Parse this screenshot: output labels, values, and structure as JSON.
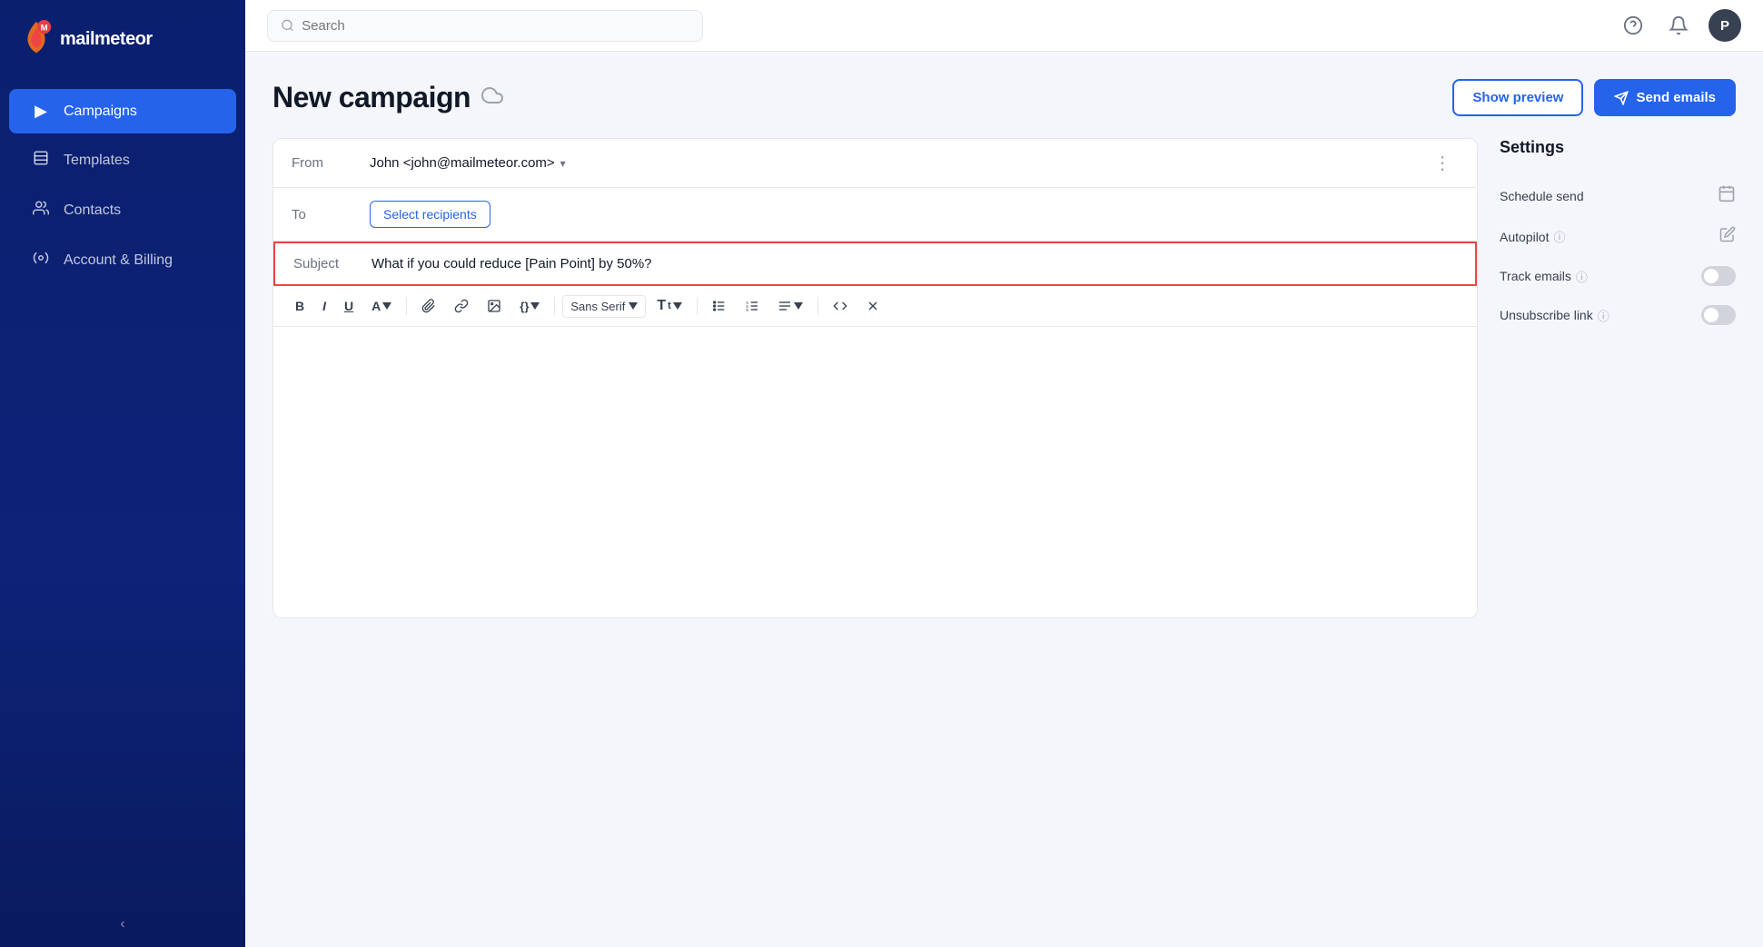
{
  "app": {
    "name": "mailmeteor",
    "logo_letter": "M"
  },
  "sidebar": {
    "items": [
      {
        "id": "campaigns",
        "label": "Campaigns",
        "icon": "▶",
        "active": true
      },
      {
        "id": "templates",
        "label": "Templates",
        "icon": "📄",
        "active": false
      },
      {
        "id": "contacts",
        "label": "Contacts",
        "icon": "👥",
        "active": false
      },
      {
        "id": "account-billing",
        "label": "Account & Billing",
        "icon": "⚙",
        "active": false
      }
    ],
    "collapse_label": "‹"
  },
  "topbar": {
    "search_placeholder": "Search",
    "help_icon": "?",
    "notification_icon": "🔔",
    "avatar_letter": "P"
  },
  "page": {
    "title": "New campaign",
    "cloud_icon": "☁",
    "show_preview_label": "Show preview",
    "send_emails_label": "Send emails"
  },
  "composer": {
    "from_label": "From",
    "from_value": "John <john@mailmeteor.com>",
    "to_label": "To",
    "select_recipients_label": "Select recipients",
    "subject_label": "Subject",
    "subject_value": "What if you could reduce [Pain Point] by 50%?"
  },
  "toolbar": {
    "bold": "B",
    "italic": "I",
    "underline": "U",
    "font_color": "A",
    "attach": "📎",
    "link": "🔗",
    "image": "🖼",
    "variable": "{}",
    "font_family": "Sans Serif",
    "font_size": "Tt",
    "bullet_list": "≡",
    "numbered_list": "≣",
    "align": "≡",
    "code": "<>",
    "clear": "✕"
  },
  "settings": {
    "title": "Settings",
    "items": [
      {
        "id": "schedule-send",
        "label": "Schedule send",
        "type": "icon",
        "icon": "📅"
      },
      {
        "id": "autopilot",
        "label": "Autopilot",
        "type": "icon",
        "icon": "✏",
        "has_info": true
      },
      {
        "id": "track-emails",
        "label": "Track emails",
        "type": "toggle",
        "value": false,
        "has_info": true
      },
      {
        "id": "unsubscribe-link",
        "label": "Unsubscribe link",
        "type": "toggle",
        "value": false,
        "has_info": true
      }
    ]
  },
  "colors": {
    "primary": "#2563eb",
    "danger": "#ef4444",
    "sidebar_bg": "#0a1f6e",
    "active_nav": "#2563eb"
  }
}
